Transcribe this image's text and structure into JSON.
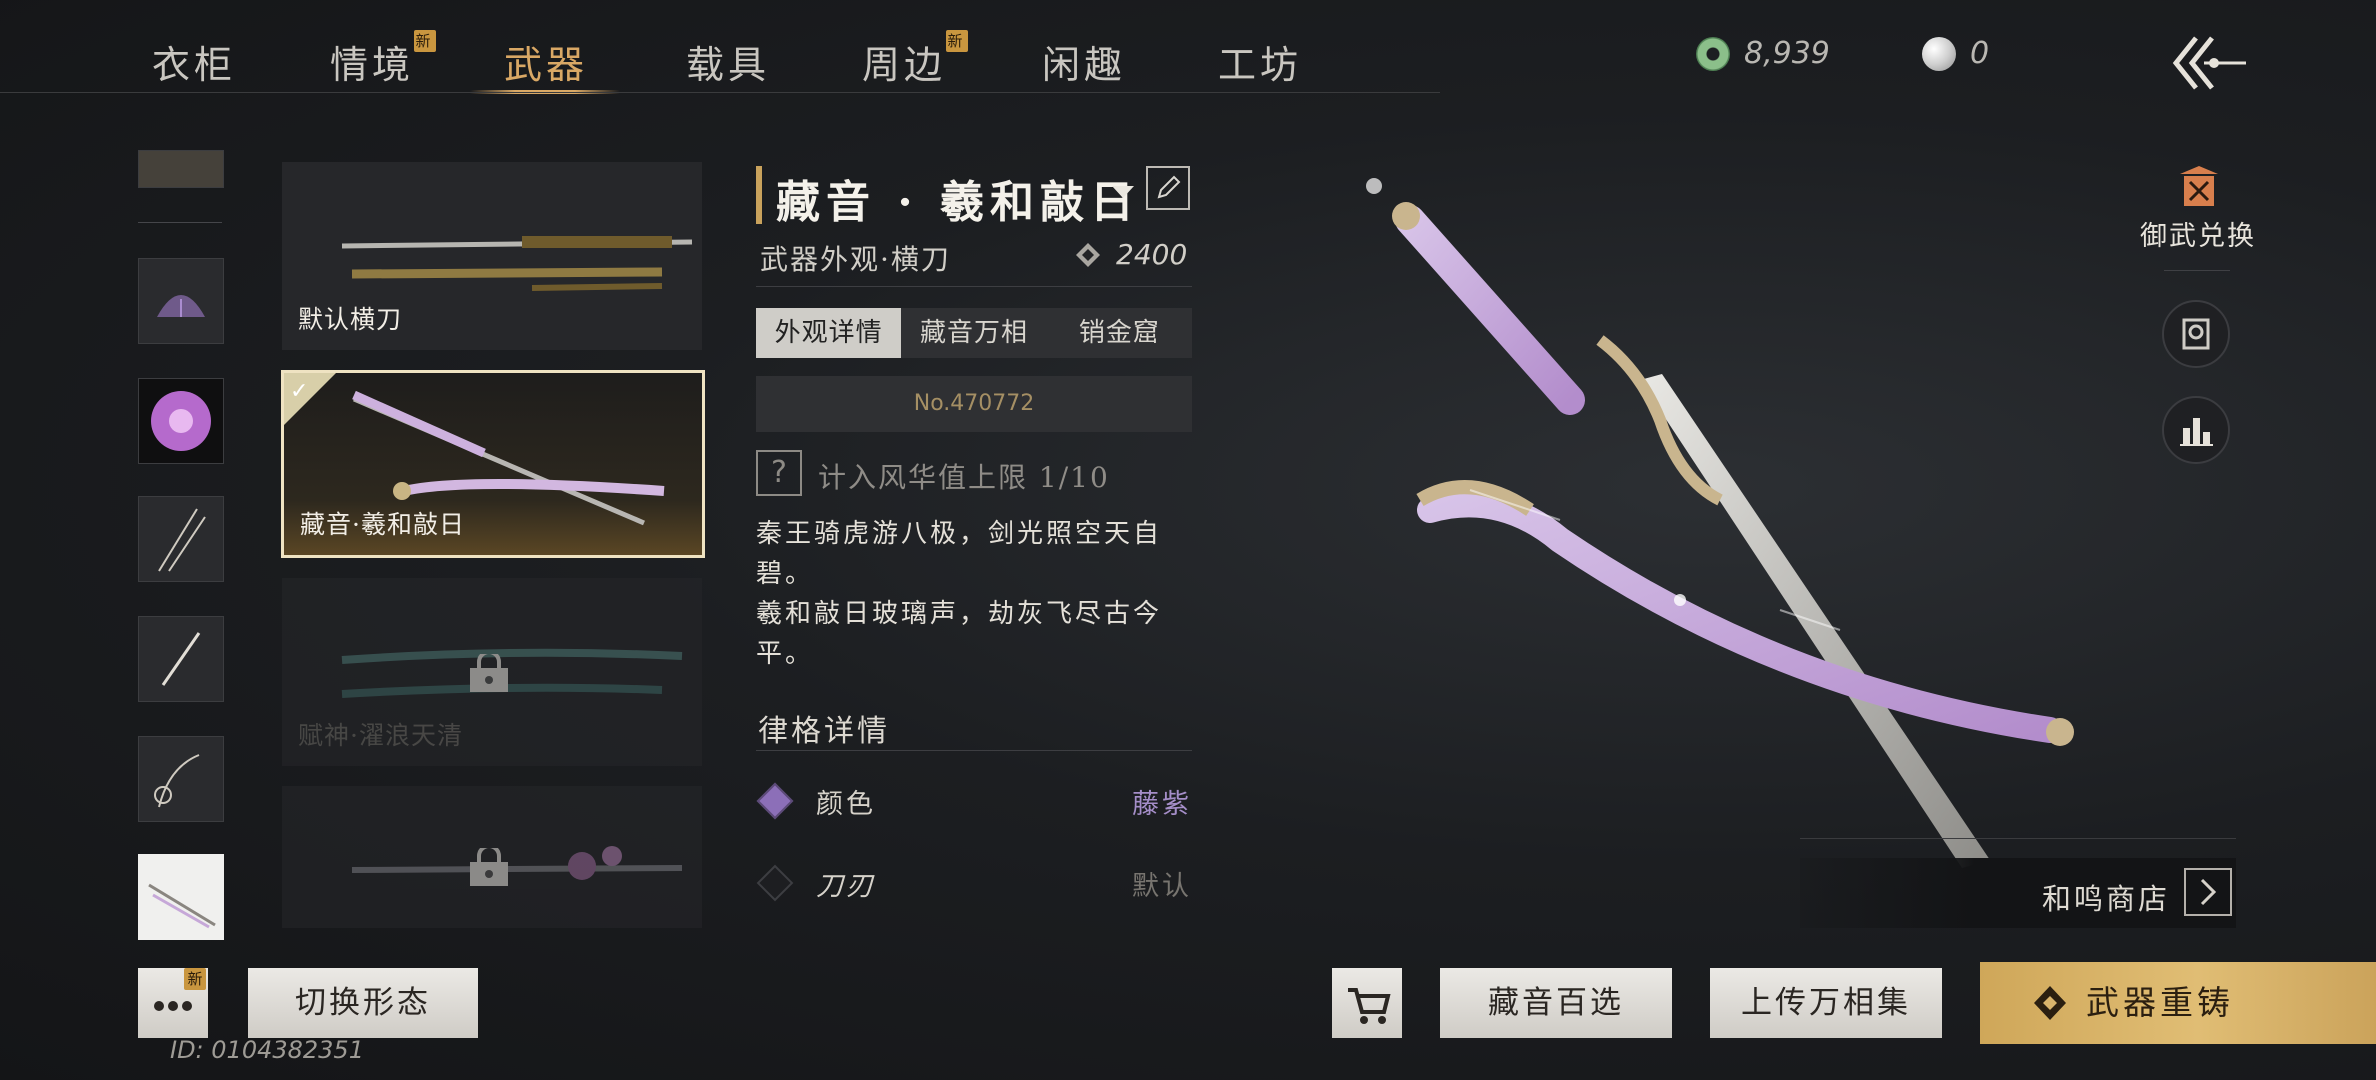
{
  "nav": {
    "tabs": [
      {
        "label": "衣柜"
      },
      {
        "label": "情境",
        "badge": "新"
      },
      {
        "label": "武器"
      },
      {
        "label": "载具"
      },
      {
        "label": "周边",
        "badge": "新"
      },
      {
        "label": "闲趣"
      },
      {
        "label": "工坊"
      }
    ],
    "active_tab": "武器"
  },
  "currency": {
    "jade": "8,939",
    "pearl": "0"
  },
  "cards": [
    {
      "label": "默认横刀",
      "state": "owned"
    },
    {
      "label": "藏音·羲和敲日",
      "state": "selected"
    },
    {
      "label": "赋神·濯浪天清",
      "state": "locked"
    },
    {
      "label": "",
      "state": "locked"
    }
  ],
  "detail": {
    "title": "藏音 · 羲和敲日",
    "subtitle": "武器外观·横刀",
    "price": "2400",
    "subtabs": [
      "外观详情",
      "藏音万相",
      "销金窟"
    ],
    "active_subtab": "外观详情",
    "serial": "No.470772",
    "count_text": "计入风华值上限 1/10",
    "description_lines": [
      "秦王骑虎游八极，剑光照空天自",
      "碧。",
      "羲和敲日玻璃声，劫灰飞尽古今",
      "平。"
    ],
    "section_title": "律格详情",
    "attributes": [
      {
        "name": "颜色",
        "value": "藤紫",
        "value_color": "#a58ec9"
      },
      {
        "name": "刀刃",
        "value": "默认",
        "value_color": "#77746f"
      }
    ]
  },
  "side": {
    "exchange_label": "御武兑换",
    "shop_label": "和鸣商店"
  },
  "bottom": {
    "more_badge": "新",
    "switch_form": "切换形态",
    "collection": "藏音百选",
    "upload": "上传万相集",
    "reforge": "武器重铸",
    "player_id": "ID: 0104382351"
  },
  "icons": [
    "jade-coin-icon",
    "pearl-icon",
    "back-arrow-icon",
    "edit-icon",
    "dropdown-icon",
    "diamond-icon",
    "help-icon",
    "cart-icon",
    "more-icon",
    "exchange-icon",
    "portrait-icon",
    "stats-icon",
    "arrow-right-icon",
    "lock-icon",
    "check-icon"
  ],
  "colors": {
    "accent_gold": "#d9a865",
    "purple": "#a58ec9"
  }
}
